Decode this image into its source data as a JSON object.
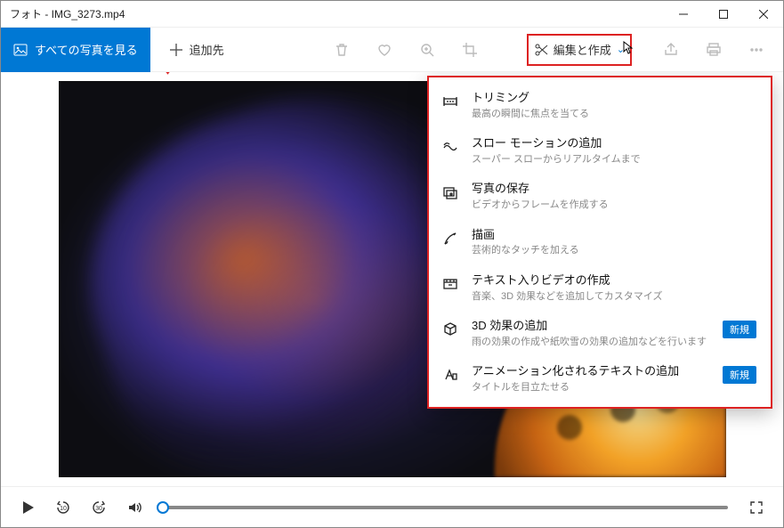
{
  "title": "フォト - IMG_3273.mp4",
  "toolbar": {
    "view_all_label": "すべての写真を見る",
    "add_to_label": "追加先",
    "edit_label": "編集と作成"
  },
  "menu": {
    "items": [
      {
        "title": "トリミング",
        "desc": "最高の瞬間に焦点を当てる",
        "icon": "trim"
      },
      {
        "title": "スロー モーションの追加",
        "desc": "スーパー スローからリアルタイムまで",
        "icon": "slowmo"
      },
      {
        "title": "写真の保存",
        "desc": "ビデオからフレームを作成する",
        "icon": "savephoto"
      },
      {
        "title": "描画",
        "desc": "芸術的なタッチを加える",
        "icon": "draw"
      },
      {
        "title": "テキスト入りビデオの作成",
        "desc": "音楽、3D 効果などを追加してカスタマイズ",
        "icon": "textvideo"
      },
      {
        "title": "3D 効果の追加",
        "desc": "雨の効果の作成や紙吹雪の効果の追加などを行います",
        "icon": "3d",
        "badge": "新規"
      },
      {
        "title": "アニメーション化されるテキストの追加",
        "desc": "タイトルを目立たせる",
        "icon": "animtext",
        "badge": "新規"
      }
    ]
  },
  "playback": {
    "skip_back": "10",
    "skip_fwd": "30",
    "progress": 0
  },
  "colors": {
    "accent": "#0078d4",
    "highlight": "#d22"
  }
}
